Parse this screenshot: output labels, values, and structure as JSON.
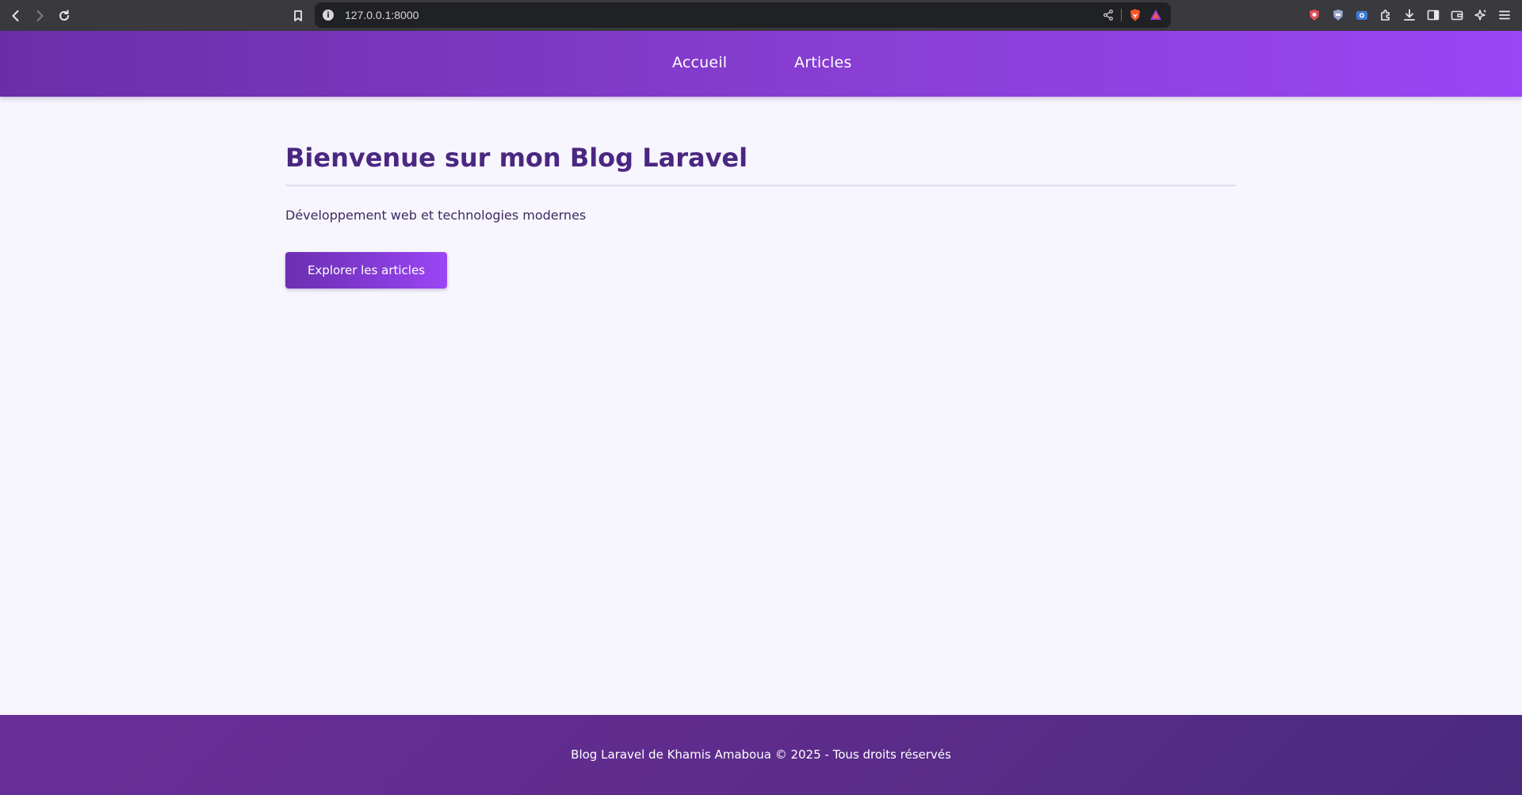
{
  "browser": {
    "url": "127.0.0.1:8000",
    "info_glyph": "i",
    "icons": [
      "back-icon",
      "forward-icon",
      "reload-icon",
      "bookmark-icon",
      "site-info-icon",
      "share-icon",
      "brave-shields-icon",
      "brave-rewards-icon",
      "shield-extension-icon",
      "privacy-badger-icon",
      "screenshot-extension-icon",
      "extensions-icon",
      "downloads-icon",
      "sidebar-icon",
      "wallet-icon",
      "leo-ai-icon",
      "menu-icon"
    ]
  },
  "header": {
    "nav": [
      {
        "label": "Accueil"
      },
      {
        "label": "Articles"
      }
    ]
  },
  "main": {
    "title": "Bienvenue sur mon Blog Laravel",
    "subtitle": "Développement web et technologies modernes",
    "cta_label": "Explorer les articles"
  },
  "footer": {
    "text": "Blog Laravel de Khamis Amaboua © 2025 - Tous droits réservés"
  },
  "colors": {
    "accent": "#8a3fd6",
    "title": "#4a2781",
    "background": "#f7f5fd"
  }
}
